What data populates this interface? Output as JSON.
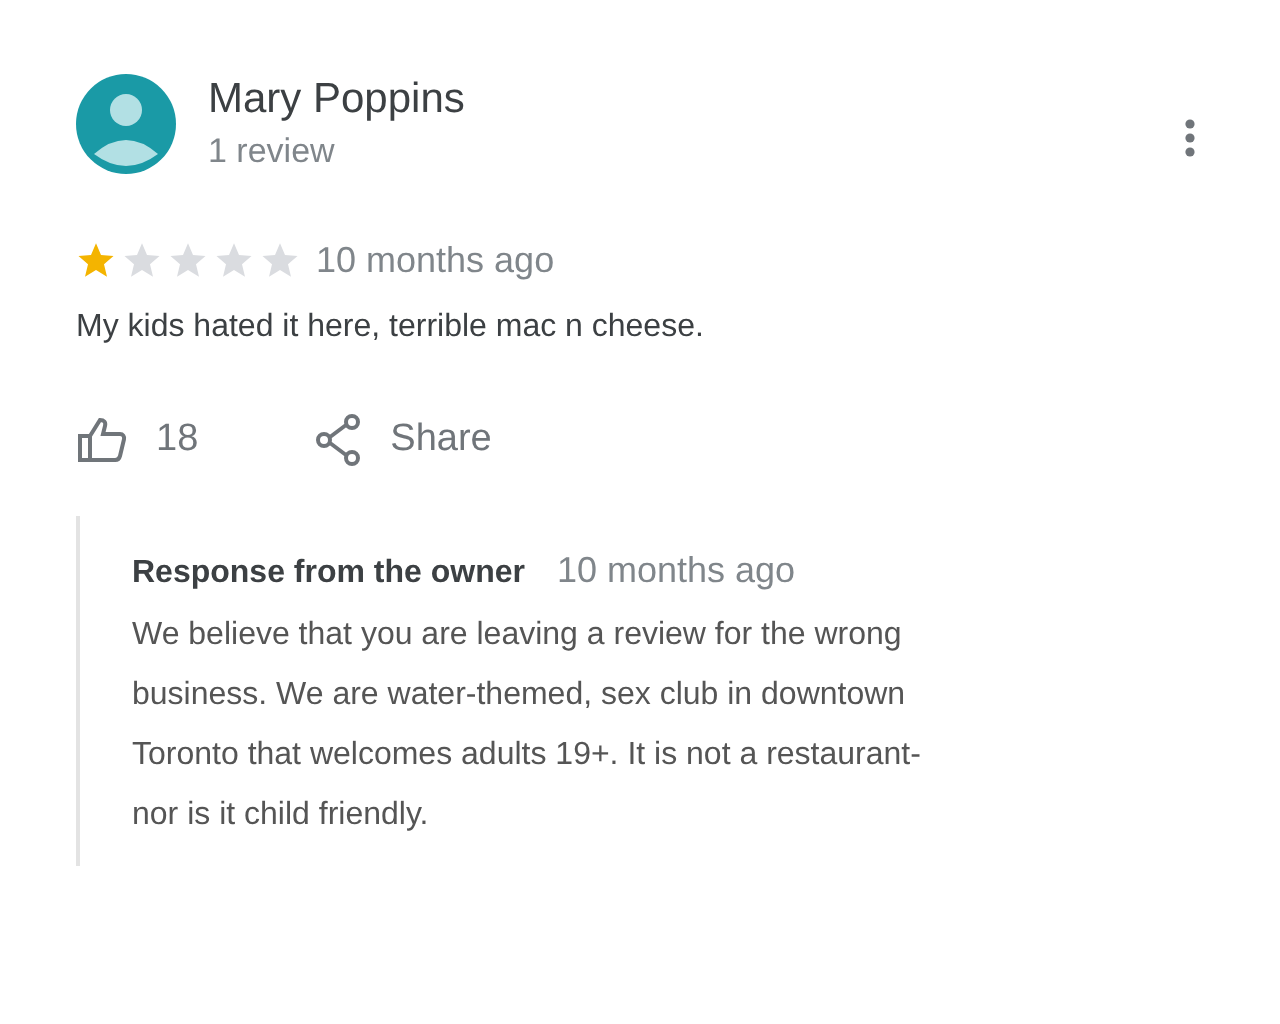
{
  "review": {
    "author": "Mary Poppins",
    "author_meta": "1 review",
    "stars": 1,
    "time": "10 months ago",
    "text": "My kids hated it here, terrible mac n cheese.",
    "likes": "18",
    "share": "Share"
  },
  "owner_response": {
    "title": "Response from the owner",
    "time": "10 months ago",
    "lines": [
      "We believe that you are leaving a review for the wrong",
      "business. We are water-themed, sex club in downtown",
      "Toronto that welcomes adults 19+. It is not a restaurant-",
      "nor is it child friendly."
    ]
  }
}
